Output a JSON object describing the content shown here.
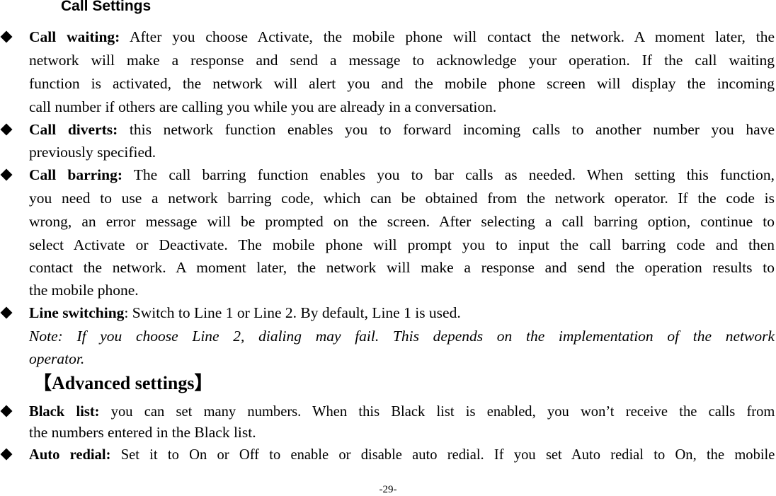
{
  "page": {
    "section_title": "Call Settings",
    "page_number": "-29-",
    "advanced_heading": "【Advanced settings】",
    "bullet_icon": "black-diamond",
    "items": [
      {
        "term": "Call waiting:",
        "lines": [
          " After you choose Activate, the mobile phone will contact the network. A moment later, the",
          "network will make a response and send a message to acknowledge your operation. If the call waiting",
          "function is activated, the network will alert you and the mobile phone screen will display the incoming",
          "call number if others are calling you while you are already in a conversation."
        ]
      },
      {
        "term": "Call diverts:",
        "lines": [
          " this network function enables you to forward incoming calls to another number you have",
          "previously specified."
        ]
      },
      {
        "term": "Call barring:",
        "lines": [
          " The call barring function enables you to bar calls as needed. When setting this function,",
          "you need to use a network barring code, which can be obtained from the network operator. If the code is",
          "wrong, an error message will be prompted on the screen. After selecting a call barring option, continue to",
          "select Activate or Deactivate. The mobile phone will prompt you to input the call barring code and then",
          "contact the network. A moment later, the network will make a response and send the operation results to",
          "the mobile phone."
        ]
      },
      {
        "term": "Line switching",
        "lines": [
          ": Switch to Line 1 or Line 2. By default, Line 1 is used."
        ],
        "note_lines": [
          "Note: If you choose Line 2, dialing may fail. This depends on the implementation of the network",
          "operator."
        ]
      },
      {
        "term": "Black list:",
        "lines": [
          " you can set many numbers. When this Black list is enabled, you won’t receive the calls from",
          "the numbers entered in the Black list."
        ]
      },
      {
        "term": "Auto redial:",
        "lines": [
          " Set it to On or Off to enable or disable auto redial. If you set Auto redial to On, the mobile"
        ]
      }
    ]
  }
}
